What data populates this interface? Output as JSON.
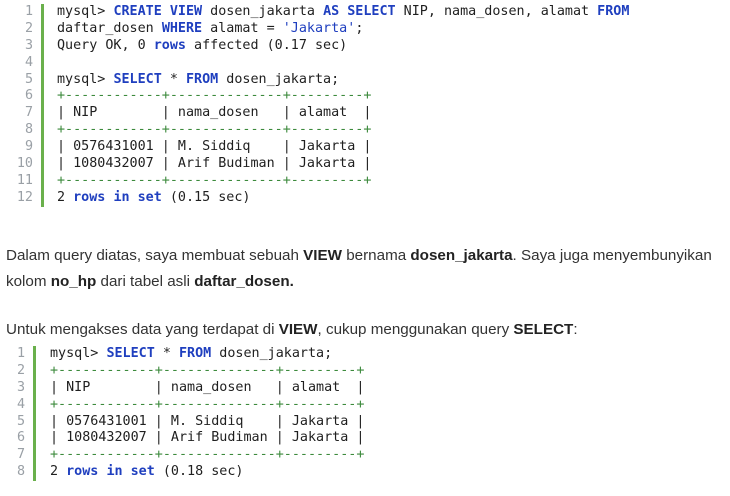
{
  "code_block_1": {
    "lines": [
      {
        "n": "1",
        "parts": [
          [
            "t",
            "mysql> "
          ],
          [
            "k",
            "CREATE VIEW"
          ],
          [
            "t",
            " dosen_jakarta "
          ],
          [
            "k",
            "AS SELECT"
          ],
          [
            "t",
            " NIP, nama_dosen, alamat "
          ],
          [
            "k",
            "FROM"
          ]
        ]
      },
      {
        "n": "2",
        "parts": [
          [
            "t",
            "daftar_dosen "
          ],
          [
            "k",
            "WHERE"
          ],
          [
            "t",
            " alamat = "
          ],
          [
            "s",
            "'Jakarta'"
          ],
          [
            "t",
            ";"
          ]
        ]
      },
      {
        "n": "3",
        "parts": [
          [
            "t",
            "Query OK, 0 "
          ],
          [
            "k",
            "rows"
          ],
          [
            "t",
            " affected (0.17 sec)"
          ]
        ]
      },
      {
        "n": "4",
        "parts": [
          [
            "t",
            ""
          ]
        ]
      },
      {
        "n": "5",
        "parts": [
          [
            "t",
            "mysql> "
          ],
          [
            "k",
            "SELECT"
          ],
          [
            "t",
            " * "
          ],
          [
            "k",
            "FROM"
          ],
          [
            "t",
            " dosen_jakarta;"
          ]
        ]
      },
      {
        "n": "6",
        "parts": [
          [
            "d",
            "+------------+--------------+---------+"
          ]
        ]
      },
      {
        "n": "7",
        "parts": [
          [
            "t",
            "| NIP        | nama_dosen   | alamat  |"
          ]
        ]
      },
      {
        "n": "8",
        "parts": [
          [
            "d",
            "+------------+--------------+---------+"
          ]
        ]
      },
      {
        "n": "9",
        "parts": [
          [
            "t",
            "| 0576431001 | M. Siddiq    | Jakarta |"
          ]
        ]
      },
      {
        "n": "10",
        "parts": [
          [
            "t",
            "| 1080432007 | Arif Budiman | Jakarta |"
          ]
        ]
      },
      {
        "n": "11",
        "parts": [
          [
            "d",
            "+------------+--------------+---------+"
          ]
        ]
      },
      {
        "n": "12",
        "parts": [
          [
            "t",
            "2 "
          ],
          [
            "k",
            "rows"
          ],
          [
            "t",
            " "
          ],
          [
            "k",
            "in"
          ],
          [
            "t",
            " "
          ],
          [
            "k",
            "set"
          ],
          [
            "t",
            " (0.15 sec)"
          ]
        ]
      }
    ]
  },
  "paragraph_1": {
    "segments": [
      {
        "text": "Dalam query diatas, saya membuat sebuah ",
        "bold": false
      },
      {
        "text": "VIEW",
        "bold": true
      },
      {
        "text": " bernama ",
        "bold": false
      },
      {
        "text": "dosen_jakarta",
        "bold": true
      },
      {
        "text": ". Saya juga menyembunyikan kolom ",
        "bold": false
      },
      {
        "text": "no_hp",
        "bold": true
      },
      {
        "text": " dari tabel asli ",
        "bold": false
      },
      {
        "text": "daftar_dosen.",
        "bold": true
      }
    ]
  },
  "paragraph_2": {
    "segments": [
      {
        "text": "Untuk mengakses data yang terdapat di ",
        "bold": false
      },
      {
        "text": "VIEW",
        "bold": true
      },
      {
        "text": ", cukup menggunakan query ",
        "bold": false
      },
      {
        "text": "SELECT",
        "bold": true
      },
      {
        "text": ":",
        "bold": false
      }
    ]
  },
  "code_block_2": {
    "lines": [
      {
        "n": "1",
        "parts": [
          [
            "t",
            "mysql> "
          ],
          [
            "k",
            "SELECT"
          ],
          [
            "t",
            " * "
          ],
          [
            "k",
            "FROM"
          ],
          [
            "t",
            " dosen_jakarta;"
          ]
        ]
      },
      {
        "n": "2",
        "parts": [
          [
            "d",
            "+------------+--------------+---------+"
          ]
        ]
      },
      {
        "n": "3",
        "parts": [
          [
            "t",
            "| NIP        | nama_dosen   | alamat  |"
          ]
        ]
      },
      {
        "n": "4",
        "parts": [
          [
            "d",
            "+------------+--------------+---------+"
          ]
        ]
      },
      {
        "n": "5",
        "parts": [
          [
            "t",
            "| 0576431001 | M. Siddiq    | Jakarta |"
          ]
        ]
      },
      {
        "n": "6",
        "parts": [
          [
            "t",
            "| 1080432007 | Arif Budiman | Jakarta |"
          ]
        ]
      },
      {
        "n": "7",
        "parts": [
          [
            "d",
            "+------------+--------------+---------+"
          ]
        ]
      },
      {
        "n": "8",
        "parts": [
          [
            "t",
            "2 "
          ],
          [
            "k",
            "rows"
          ],
          [
            "t",
            " "
          ],
          [
            "k",
            "in"
          ],
          [
            "t",
            " "
          ],
          [
            "k",
            "set"
          ],
          [
            "t",
            " (0.18 sec)"
          ]
        ]
      }
    ]
  },
  "colors": {
    "keyword": "#1f3fbf",
    "line_number": "#9aa0a6",
    "gutter_border": "#6ab04c",
    "table_border": "#3c8a3c",
    "body_text": "#333333"
  }
}
